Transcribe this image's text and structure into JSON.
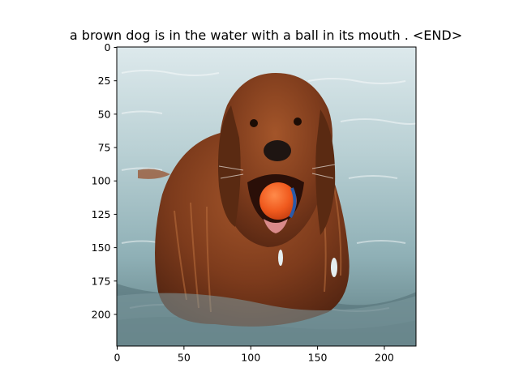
{
  "figure": {
    "title": "a brown dog is in the water with a ball in its mouth . <END>",
    "image_subject": "brown dog swimming in water with an orange ball in its mouth",
    "image_width": 224,
    "image_height": 224
  },
  "axes": {
    "x_ticks": [
      "0",
      "50",
      "100",
      "150",
      "200"
    ],
    "x_tick_values": [
      0,
      50,
      100,
      150,
      200
    ],
    "y_ticks": [
      "0",
      "25",
      "50",
      "75",
      "100",
      "125",
      "150",
      "175",
      "200"
    ],
    "y_tick_values": [
      0,
      25,
      50,
      75,
      100,
      125,
      150,
      175,
      200
    ]
  },
  "colors": {
    "water_light": "#c9dcdf",
    "water_mid": "#7f9ea6",
    "water_dark": "#4e6b70",
    "dog_fur": "#7a3a1c",
    "dog_fur_light": "#a55a2e",
    "ball": "#f05a1e",
    "ball_stripe": "#2a5aa8"
  }
}
